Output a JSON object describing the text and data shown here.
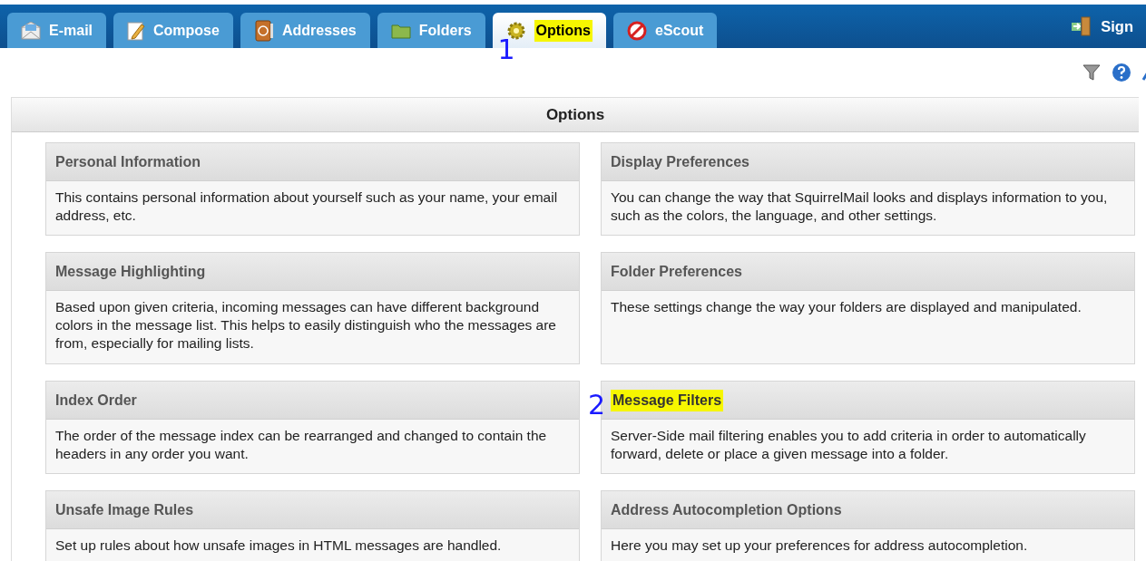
{
  "tabs": [
    {
      "label": "E-mail",
      "selected": false,
      "highlighted": false
    },
    {
      "label": "Compose",
      "selected": false,
      "highlighted": false
    },
    {
      "label": "Addresses",
      "selected": false,
      "highlighted": false
    },
    {
      "label": "Folders",
      "selected": false,
      "highlighted": false
    },
    {
      "label": "Options",
      "selected": true,
      "highlighted": true,
      "annotation": "1"
    },
    {
      "label": "eScout",
      "selected": false,
      "highlighted": false
    }
  ],
  "sign_out": {
    "label": "Sign"
  },
  "panel": {
    "title": "Options"
  },
  "options": [
    {
      "title": "Personal Information",
      "description": "This contains personal information about yourself such as your name, your email address, etc.",
      "highlighted": false
    },
    {
      "title": "Display Preferences",
      "description": "You can change the way that SquirrelMail looks and displays information to you, such as the colors, the language, and other settings.",
      "highlighted": false
    },
    {
      "title": "Message Highlighting",
      "description": "Based upon given criteria, incoming messages can have different background colors in the message list. This helps to easily distinguish who the messages are from, especially for mailing lists.",
      "highlighted": false
    },
    {
      "title": "Folder Preferences",
      "description": "These settings change the way your folders are displayed and manipulated.",
      "highlighted": false
    },
    {
      "title": "Index Order",
      "description": "The order of the message index can be rearranged and changed to contain the headers in any order you want.",
      "highlighted": false
    },
    {
      "title": "Message Filters",
      "description": "Server-Side mail filtering enables you to add criteria in order to automatically forward, delete or place a given message into a folder.",
      "highlighted": true,
      "annotation": "2"
    },
    {
      "title": "Unsafe Image Rules",
      "description": "Set up rules about how unsafe images in HTML messages are handled.",
      "highlighted": false
    },
    {
      "title": "Address Autocompletion Options",
      "description": "Here you may set up your preferences for address autocompletion.",
      "highlighted": false
    }
  ]
}
